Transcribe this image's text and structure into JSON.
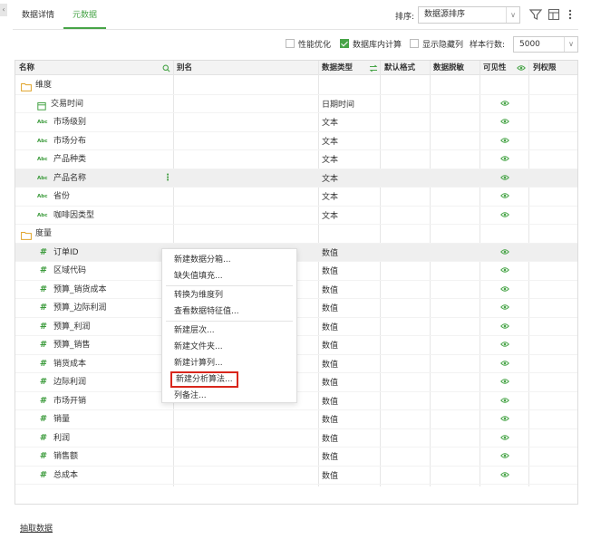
{
  "tabs": [
    {
      "label": "数据详情",
      "active": false
    },
    {
      "label": "元数据",
      "active": true
    }
  ],
  "sort": {
    "label": "排序:",
    "value": "数据源排序"
  },
  "options": {
    "performance": {
      "label": "性能优化",
      "checked": false
    },
    "db_compute": {
      "label": "数据库内计算",
      "checked": true
    },
    "show_hidden": {
      "label": "显示隐藏列",
      "checked": false
    },
    "sample_rows_label": "样本行数:",
    "sample_rows_value": "5000"
  },
  "columns": {
    "name": "名称",
    "alias": "别名",
    "data_type": "数据类型",
    "default_format": "默认格式",
    "masking": "数据脱敏",
    "visibility": "可见性",
    "column_permission": "列权限"
  },
  "groups": {
    "dimension": "维度",
    "measure": "度量"
  },
  "dimension_rows": [
    {
      "name": "交易时间",
      "icon": "calendar-icon",
      "type": "日期时间"
    },
    {
      "name": "市场级别",
      "icon": "abc-icon",
      "type": "文本"
    },
    {
      "name": "市场分布",
      "icon": "abc-icon",
      "type": "文本"
    },
    {
      "name": "产品种类",
      "icon": "abc-icon",
      "type": "文本"
    },
    {
      "name": "产品名称",
      "icon": "abc-icon",
      "type": "文本"
    },
    {
      "name": "省份",
      "icon": "abc-icon",
      "type": "文本"
    },
    {
      "name": "咖啡因类型",
      "icon": "abc-icon",
      "type": "文本"
    }
  ],
  "measure_rows": [
    {
      "name": "订单ID",
      "icon": "hash-icon",
      "type": "数值"
    },
    {
      "name": "区域代码",
      "icon": "hash-icon",
      "type": "数值"
    },
    {
      "name": "预算_销货成本",
      "icon": "hash-icon",
      "type": "数值"
    },
    {
      "name": "预算_边际利润",
      "icon": "hash-icon",
      "type": "数值"
    },
    {
      "name": "预算_利润",
      "icon": "hash-icon",
      "type": "数值"
    },
    {
      "name": "预算_销售",
      "icon": "hash-icon",
      "type": "数值"
    },
    {
      "name": "销货成本",
      "icon": "hash-icon",
      "type": "数值"
    },
    {
      "name": "边际利润",
      "icon": "hash-icon",
      "type": "数值"
    },
    {
      "name": "市场开销",
      "icon": "hash-icon",
      "type": "数值"
    },
    {
      "name": "销量",
      "icon": "hash-icon",
      "type": "数值"
    },
    {
      "name": "利润",
      "icon": "hash-icon",
      "type": "数值"
    },
    {
      "name": "销售额",
      "icon": "hash-icon",
      "type": "数值"
    },
    {
      "name": "总成本",
      "icon": "hash-icon",
      "type": "数值"
    }
  ],
  "icon_glyphs": {
    "abc": "Abc",
    "hash": "#"
  },
  "context_menu": [
    "新建数据分箱...",
    "缺失值填充...",
    "转换为维度列",
    "查看数据特征值...",
    "新建层次...",
    "新建文件夹...",
    "新建计算列...",
    "新建分析算法...",
    "列备注..."
  ],
  "footer": {
    "extract_label": "抽取数据"
  },
  "colors": {
    "accent": "#47a447",
    "highlight_box": "#d9261c",
    "folder": "#e0a42a"
  }
}
